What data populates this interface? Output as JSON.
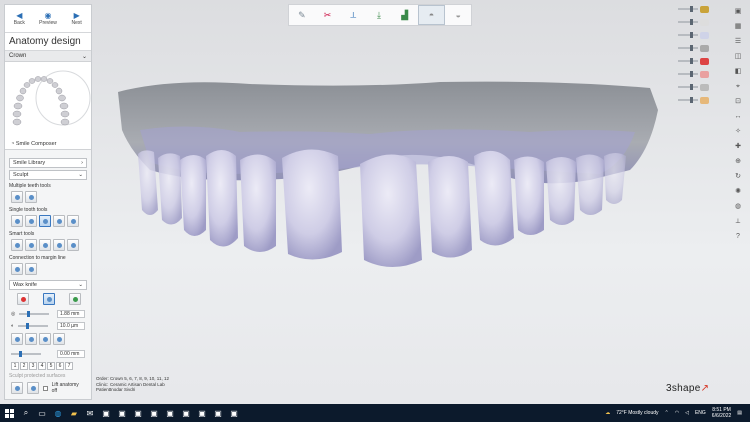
{
  "nav": {
    "back_label": "Back",
    "preview_label": "Preview",
    "next_label": "Next"
  },
  "panel": {
    "title": "Anatomy design",
    "crown_section": "Crown",
    "smile_composer_label": "Smile Composer",
    "smile_library_label": "Smile Library",
    "sculpt_label": "Sculpt",
    "multiple_teeth_tools": "Multiple teeth tools",
    "single_tooth_tools": "Single tooth tools",
    "smart_tools": "Smart tools",
    "connection_to_margin_line": "Connection to margin line",
    "wax_knife_label": "Wax knife",
    "wax_value_1": "1.88 mm",
    "wax_value_2": "10.0 µm",
    "wax_value_3": "0.00 mm",
    "number_buttons": [
      "1",
      "2",
      "3",
      "4",
      "5",
      "6",
      "7"
    ],
    "sculpt_protected": "Sculpt protected surfaces",
    "lift_anatomy_off": "Lift anatomy off"
  },
  "order_info": {
    "order_key": "Order:",
    "order_val": "Crown 5, 6, 7, 8, 9, 10, 11, 12",
    "clinic_key": "Clinic:",
    "clinic_val": "Ceramic Artisan Dental Lab",
    "patient_key": "Patient:",
    "patient_val": "Inodar Sivdri"
  },
  "brand": {
    "prefix": "3",
    "name": "shape"
  },
  "taskbar": {
    "weather": "72°F  Mostly cloudy",
    "lang": "ENG",
    "time": "8:51 PM",
    "date": "6/6/2022"
  },
  "colors": {
    "accent": "#2c6fb5",
    "tooth": "#d3d2ea",
    "gum": "#8f9399",
    "brand_red": "#d6301f"
  }
}
